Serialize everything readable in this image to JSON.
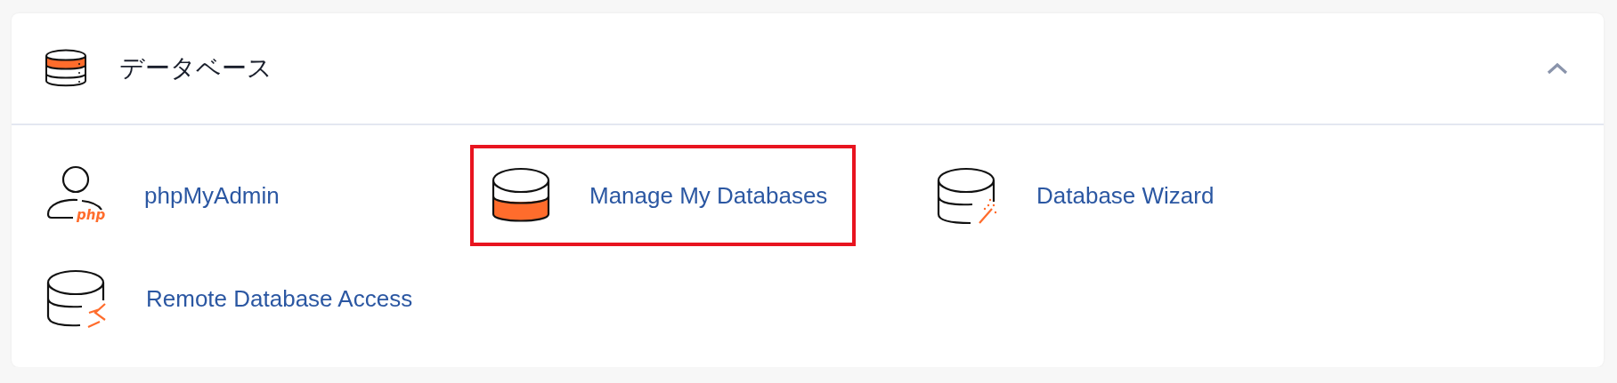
{
  "section": {
    "title": "データベース",
    "expanded": true,
    "items": [
      {
        "kind": "phpmyadmin",
        "label": "phpMyAdmin",
        "icon_text": "php",
        "highlighted": false
      },
      {
        "kind": "manage",
        "label": "Manage My Databases",
        "highlighted": true
      },
      {
        "kind": "wizard",
        "label": "Database Wizard",
        "highlighted": false
      },
      {
        "kind": "remote",
        "label": "Remote Database Access",
        "highlighted": false
      }
    ]
  }
}
